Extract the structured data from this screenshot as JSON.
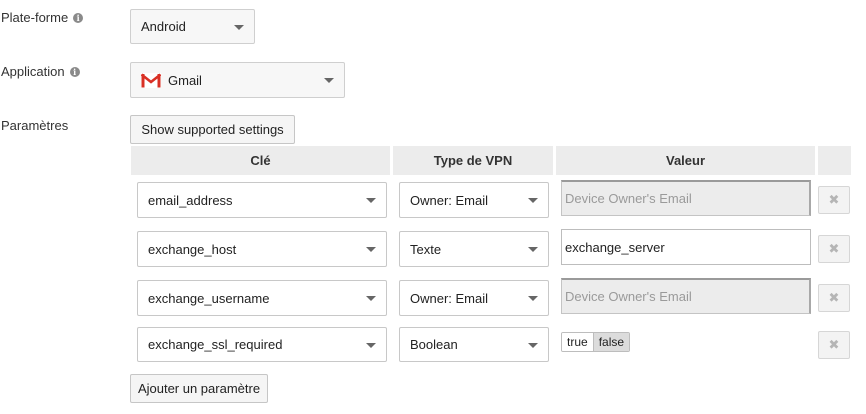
{
  "platform": {
    "label": "Plate-forme",
    "value": "Android"
  },
  "application": {
    "label": "Application",
    "value": "Gmail"
  },
  "params": {
    "label": "Paramètres",
    "show_settings_button": "Show supported settings",
    "headers": {
      "key": "Clé",
      "type": "Type de VPN",
      "value": "Valeur"
    },
    "rows": [
      {
        "key": "email_address",
        "type": "Owner: Email",
        "value": "Device Owner's Email"
      },
      {
        "key": "exchange_host",
        "type": "Texte",
        "value": "exchange_server"
      },
      {
        "key": "exchange_username",
        "type": "Owner: Email",
        "value": "Device Owner's Email"
      },
      {
        "key": "exchange_ssl_required",
        "type": "Boolean",
        "toggle": {
          "true_label": "true",
          "false_label": "false",
          "selected": "false"
        }
      }
    ],
    "add_button": "Ajouter un paramètre"
  },
  "icons": {
    "info": "info-icon",
    "gmail": "gmail-icon",
    "remove": "close-icon",
    "dropdown": "chevron-down-icon"
  }
}
